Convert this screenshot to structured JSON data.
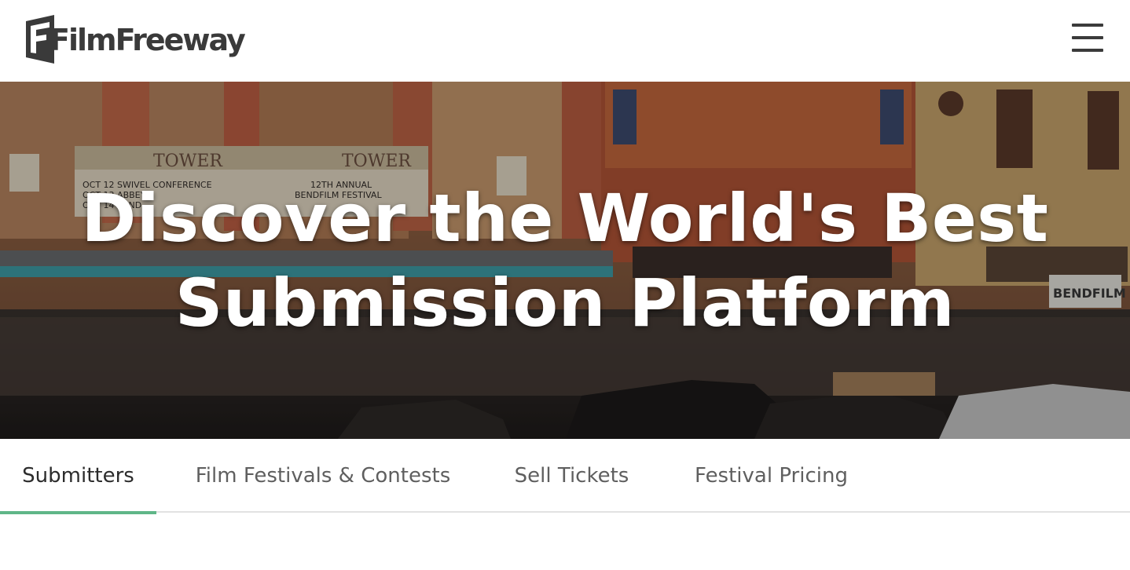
{
  "header": {
    "logo_text": "FilmFreeway",
    "menu_icon": "hamburger-menu-icon"
  },
  "hero": {
    "title_line1": "Discover the World's Best",
    "title_line2": "Submission Platform",
    "marquee_left": "TOWER",
    "marquee_right": "TOWER",
    "marquee_left_lines": [
      "OCT 12 SWIVEL CONFERENCE",
      "OCT 13 ABBEY",
      "OCT 14 BEND"
    ],
    "marquee_right_lines": [
      "12TH ANNUAL",
      "BENDFILM FESTIVAL"
    ],
    "banner": "BENDFILM"
  },
  "tabs": [
    {
      "label": "Submitters",
      "active": true
    },
    {
      "label": "Film Festivals & Contests",
      "active": false
    },
    {
      "label": "Sell Tickets",
      "active": false
    },
    {
      "label": "Festival Pricing",
      "active": false
    }
  ],
  "colors": {
    "accent": "#5fb688",
    "text_dark": "#2c2c2c",
    "text_muted": "#5f5f5f",
    "logo": "#3a3a3a"
  }
}
